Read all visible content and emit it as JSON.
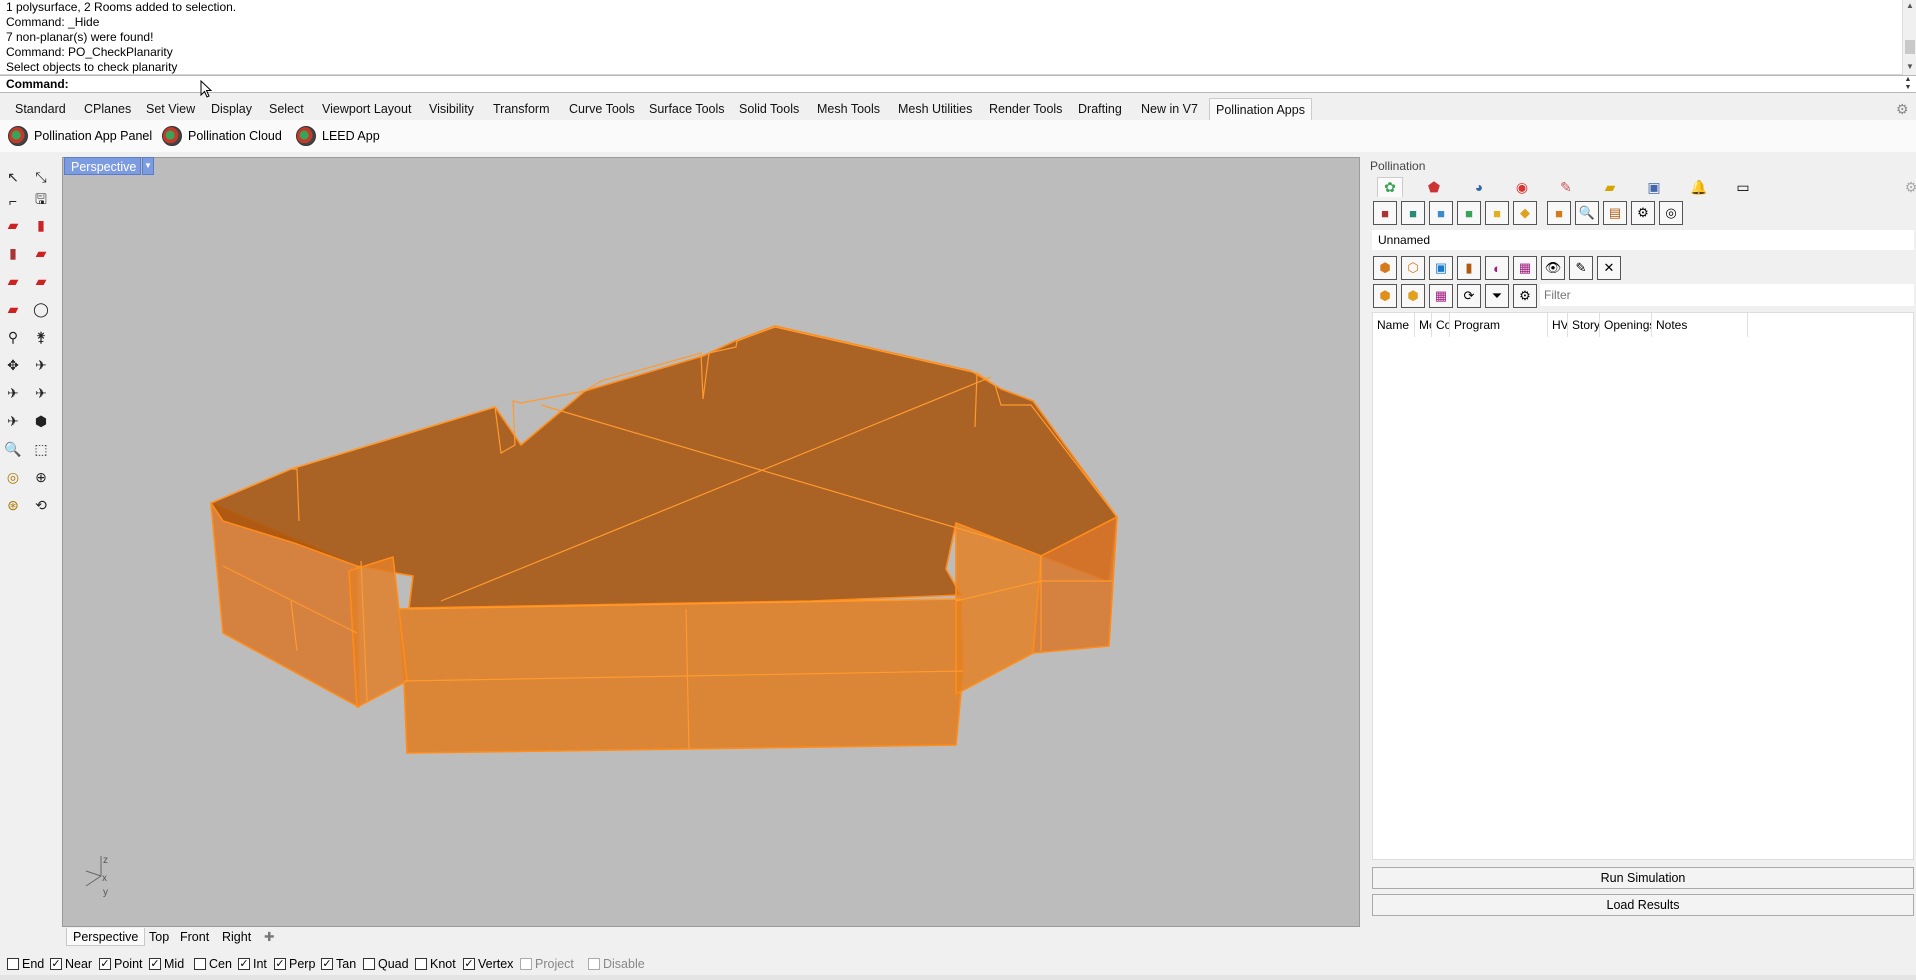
{
  "command_history": [
    "1 polysurface, 2 Rooms added to selection.",
    "Command: _Hide",
    "7 non-planar(s) were found!",
    "Command: PO_CheckPlanarity",
    "Select objects to check planarity"
  ],
  "command_prompt": "Command:",
  "toolbar_tabs": [
    "Standard",
    "CPlanes",
    "Set View",
    "Display",
    "Select",
    "Viewport Layout",
    "Visibility",
    "Transform",
    "Curve Tools",
    "Surface Tools",
    "Solid Tools",
    "Mesh Tools",
    "Mesh Utilities",
    "Render Tools",
    "Drafting",
    "New in V7",
    "Pollination Apps"
  ],
  "active_tab": "Pollination Apps",
  "app_buttons": [
    "Pollination App Panel",
    "Pollination Cloud",
    "LEED App"
  ],
  "viewport": {
    "label": "Perspective",
    "axes": {
      "x": "x",
      "y": "y",
      "z": "z"
    },
    "model_color": "#d96a0f",
    "edge_color": "#ff8c1a"
  },
  "viewport_tabs": [
    "Perspective",
    "Top",
    "Front",
    "Right"
  ],
  "active_viewport_tab": "Perspective",
  "osnaps": [
    {
      "label": "End",
      "checked": false,
      "enabled": true
    },
    {
      "label": "Near",
      "checked": true,
      "enabled": true
    },
    {
      "label": "Point",
      "checked": true,
      "enabled": true
    },
    {
      "label": "Mid",
      "checked": true,
      "enabled": true
    },
    {
      "label": "Cen",
      "checked": false,
      "enabled": true
    },
    {
      "label": "Int",
      "checked": true,
      "enabled": true
    },
    {
      "label": "Perp",
      "checked": true,
      "enabled": true
    },
    {
      "label": "Tan",
      "checked": true,
      "enabled": true
    },
    {
      "label": "Quad",
      "checked": false,
      "enabled": true
    },
    {
      "label": "Knot",
      "checked": false,
      "enabled": true
    },
    {
      "label": "Vertex",
      "checked": true,
      "enabled": true
    },
    {
      "label": "Project",
      "checked": false,
      "enabled": false
    },
    {
      "label": "Disable",
      "checked": false,
      "enabled": false
    }
  ],
  "pollination": {
    "title": "Pollination",
    "model_name": "Unnamed",
    "filter_placeholder": "Filter",
    "columns": [
      "Name",
      "Mc",
      "Co",
      "Program",
      "HV",
      "Story",
      "Openings",
      "Notes"
    ],
    "run_simulation": "Run Simulation",
    "load_results": "Load Results"
  }
}
